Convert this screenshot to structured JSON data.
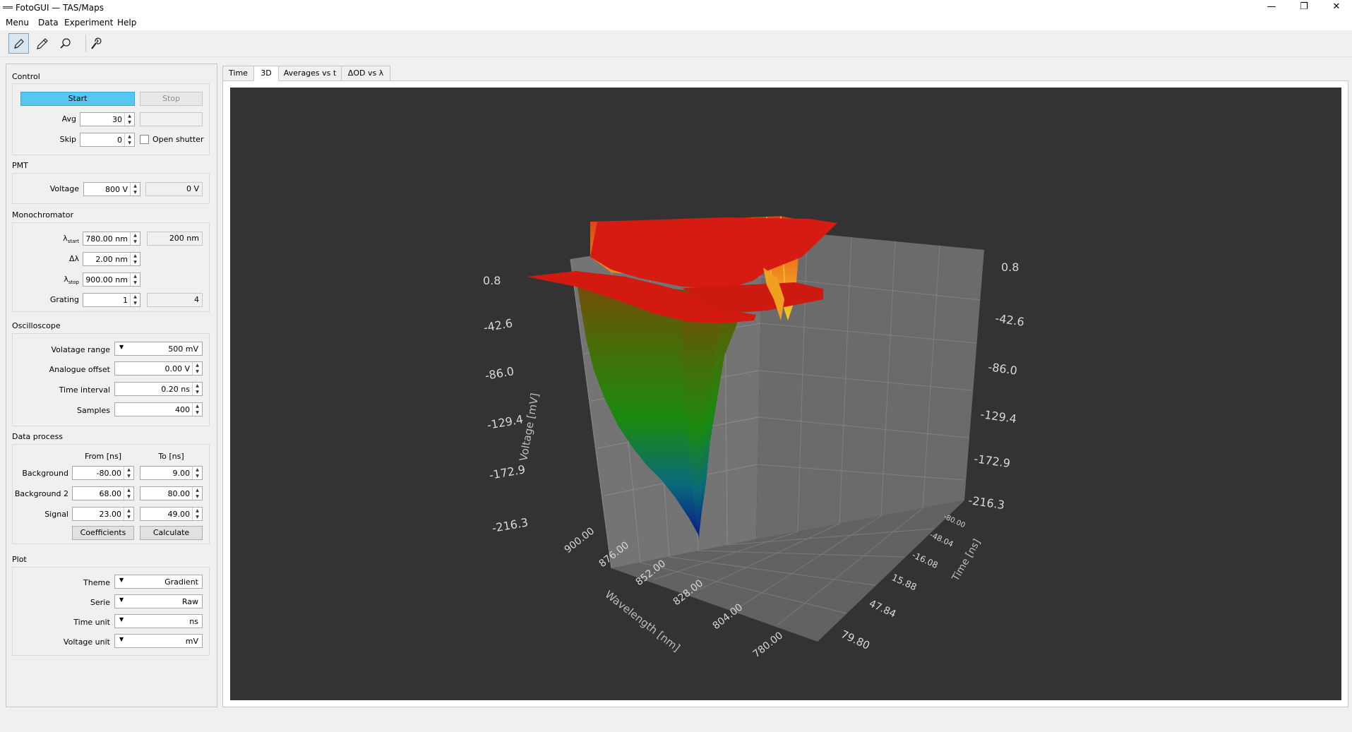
{
  "window": {
    "title": "FotoGUI — TAS/Maps",
    "minimize": "—",
    "restore": "❐",
    "close": "✕"
  },
  "menubar": [
    "Menu",
    "Data",
    "Experiment",
    "Help"
  ],
  "toolbar": {
    "icons": [
      "pencil-icon",
      "dropper-icon",
      "magnifier-icon",
      "wrench-icon"
    ]
  },
  "control": {
    "title": "Control",
    "start_label": "Start",
    "stop_label": "Stop",
    "avg_label": "Avg",
    "avg_value": "30",
    "skip_label": "Skip",
    "skip_value": "0",
    "open_shutter_label": "Open shutter"
  },
  "pmt": {
    "title": "PMT",
    "voltage_label": "Voltage",
    "voltage_value": "800 V",
    "voltage_readout": "0 V"
  },
  "monochromator": {
    "title": "Monochromator",
    "start_label": "λ",
    "start_sub": "start",
    "start_value": "780.00 nm",
    "start_readout": "200 nm",
    "delta_label": "Δλ",
    "delta_value": "2.00 nm",
    "stop_label": "λ",
    "stop_sub": "stop",
    "stop_value": "900.00 nm",
    "grating_label": "Grating",
    "grating_value": "1",
    "grating_readout": "4"
  },
  "oscilloscope": {
    "title": "Oscilloscope",
    "range_label": "Volatage range",
    "range_value": "500 mV",
    "offset_label": "Analogue offset",
    "offset_value": "0.00 V",
    "interval_label": "Time interval",
    "interval_value": "0.20 ns",
    "samples_label": "Samples",
    "samples_value": "400"
  },
  "data_process": {
    "title": "Data process",
    "from_header": "From [ns]",
    "to_header": "To [ns]",
    "rows": [
      {
        "label": "Background",
        "from": "-80.00",
        "to": "9.00"
      },
      {
        "label": "Background 2",
        "from": "68.00",
        "to": "80.00"
      },
      {
        "label": "Signal",
        "from": "23.00",
        "to": "49.00"
      }
    ],
    "coefficients_label": "Coefficients",
    "calculate_label": "Calculate"
  },
  "plot": {
    "title": "Plot",
    "theme_label": "Theme",
    "theme_value": "Gradient",
    "serie_label": "Serie",
    "serie_value": "Raw",
    "time_unit_label": "Time unit",
    "time_unit_value": "ns",
    "voltage_unit_label": "Voltage unit",
    "voltage_unit_value": "mV"
  },
  "tabs": [
    "Time",
    "3D",
    "Averages vs t",
    "ΔOD vs λ"
  ],
  "active_tab": "3D",
  "chart3d": {
    "voltage_axis_label": "Voltage [mV]",
    "wavelength_axis_label": "Wavelength [nm]",
    "time_axis_label": "Time [ns]",
    "voltage_ticks": [
      "0.8",
      "-42.6",
      "-86.0",
      "-129.4",
      "-172.9",
      "-216.3"
    ],
    "wavelength_ticks": [
      "900.00",
      "876.00",
      "852.00",
      "828.00",
      "804.00",
      "780.00"
    ],
    "time_ticks": [
      "-80.00",
      "-48.04",
      "-16.08",
      "15.88",
      "47.84",
      "79.80"
    ],
    "colors": {
      "background": "#333333",
      "high": "#e01010",
      "mid": "#2a8a10",
      "low": "#0a2a90"
    }
  }
}
